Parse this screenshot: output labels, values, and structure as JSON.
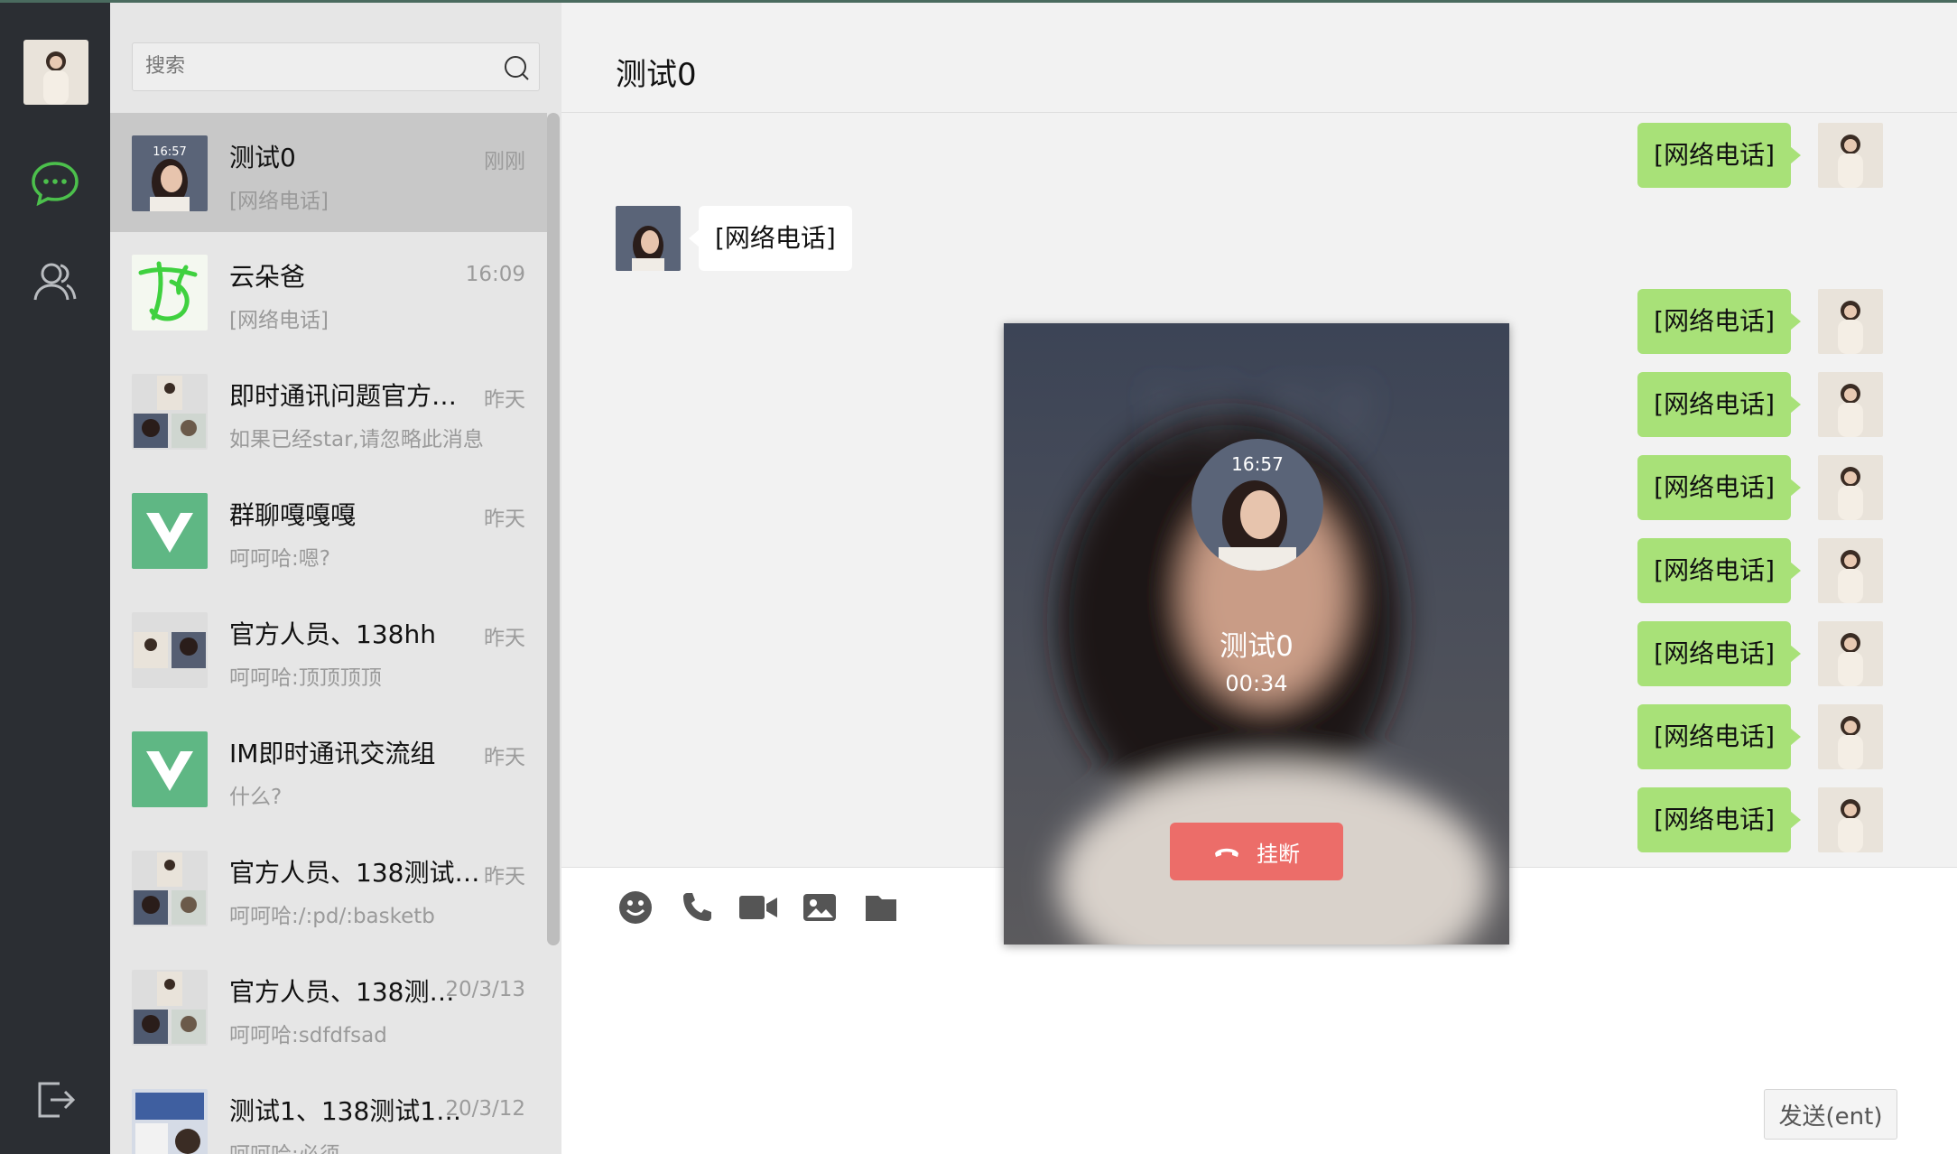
{
  "search": {
    "placeholder": "搜索"
  },
  "conversations": [
    {
      "name": "测试0",
      "time": "刚刚",
      "preview": "[网络电话]"
    },
    {
      "name": "云朵爸",
      "time": "16:09",
      "preview": "[网络电话]"
    },
    {
      "name": "即时通讯问题官方反馈群",
      "time": "昨天",
      "preview": "如果已经star,请忽略此消息"
    },
    {
      "name": "群聊嘎嘎嘎",
      "time": "昨天",
      "preview": "呵呵哈:嗯?"
    },
    {
      "name": "官方人员、138hh",
      "time": "昨天",
      "preview": "呵呵哈:顶顶顶顶"
    },
    {
      "name": "IM即时通讯交流组",
      "time": "昨天",
      "preview": "什么?"
    },
    {
      "name": "官方人员、138测试…",
      "time": "昨天",
      "preview": "呵呵哈:/:pd/:basketb"
    },
    {
      "name": "官方人员、138测…",
      "time": "20/3/13",
      "preview": "呵呵哈:sdfdfsad"
    },
    {
      "name": "测试1、138测试1…",
      "time": "20/3/12",
      "preview": "呵呵哈:必须"
    }
  ],
  "chat": {
    "title": "测试0",
    "messages": [
      {
        "dir": "out",
        "text": "[网络电话]"
      },
      {
        "dir": "in",
        "text": "[网络电话]"
      },
      {
        "dir": "out",
        "text": "[网络电话]"
      },
      {
        "dir": "out",
        "text": "[网络电话]"
      },
      {
        "dir": "out",
        "text": "[网络电话]"
      },
      {
        "dir": "out",
        "text": "[网络电话]"
      },
      {
        "dir": "out",
        "text": "[网络电话]"
      },
      {
        "dir": "out",
        "text": "[网络电话]"
      },
      {
        "dir": "out",
        "text": "[网络电话]"
      }
    ],
    "send_label": "发送(ent)"
  },
  "call": {
    "name": "测试0",
    "duration": "00:34",
    "hangup_label": "挂断",
    "avatar_clock": "16:57"
  },
  "colors": {
    "accent": "#4cc04c",
    "bubble_out": "#a8e178",
    "hangup": "#ec6d69",
    "rail": "#2b2e33"
  }
}
